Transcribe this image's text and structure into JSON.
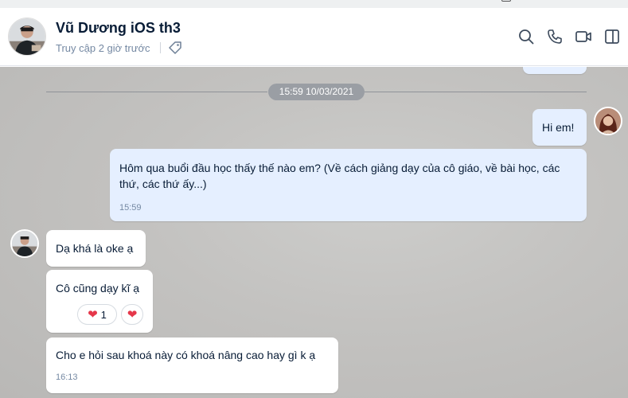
{
  "header": {
    "name": "Vũ Dương iOS th3",
    "status": "Truy cập 2 giờ trước"
  },
  "conversation": {
    "date_divider": "15:59 10/03/2021",
    "messages": [
      {
        "side": "me",
        "text": "Hi em!"
      },
      {
        "side": "me",
        "text": "Hôm qua buổi đầu học thấy thế nào em? (Về cách giảng dạy của cô giáo, về bài học, các thứ, các thứ ấy...)",
        "time": "15:59"
      },
      {
        "side": "them",
        "text": "Dạ khá là oke ạ"
      },
      {
        "side": "them",
        "text": "Cô cũng dạy kĩ ạ",
        "reaction": {
          "emoji": "heart",
          "count": "1"
        }
      },
      {
        "side": "them",
        "text": "Cho e hỏi sau khoá này có khoá nâng cao hay gì k ạ",
        "time": "16:13"
      }
    ]
  },
  "colors": {
    "my_bubble": "#e5efff",
    "their_bubble": "#ffffff",
    "heart": "#e5374a"
  }
}
